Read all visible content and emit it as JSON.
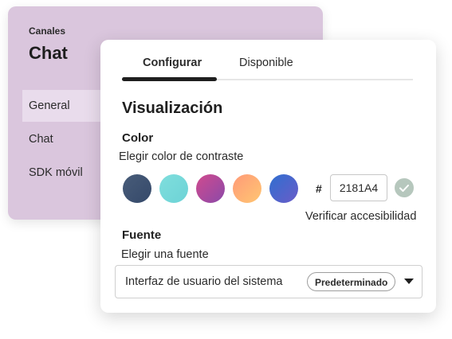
{
  "back_panel": {
    "section": "Canales",
    "title": "Chat",
    "nav": [
      "General",
      "Chat",
      "SDK móvil"
    ],
    "active_nav": "General"
  },
  "card": {
    "tabs": [
      "Configurar",
      "Disponible"
    ],
    "active_tab": "Configurar",
    "section_title": "Visualización",
    "color": {
      "label": "Color",
      "subtitle": "Elegir color de contraste",
      "swatches": [
        {
          "name": "navy",
          "from": "#485c79",
          "to": "#35496a"
        },
        {
          "name": "teal",
          "from": "#7fdedd",
          "to": "#6dd3d6"
        },
        {
          "name": "magenta",
          "from": "#d14b8e",
          "to": "#8a49a9"
        },
        {
          "name": "peach",
          "from": "#ff9a78",
          "to": "#ffc672"
        },
        {
          "name": "blue",
          "from": "#2f6fd0",
          "to": "#6a5cc8"
        }
      ],
      "hash": "#",
      "hex_value": "2181A4",
      "verify_link": "Verificar accesibilidad"
    },
    "font": {
      "label": "Fuente",
      "subtitle": "Elegir una fuente",
      "selected": "Interfaz de usuario del sistema",
      "badge": "Predeterminado"
    }
  }
}
